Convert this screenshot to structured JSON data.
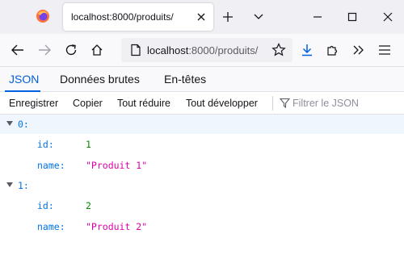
{
  "browser": {
    "tab_title": "localhost:8000/produits/",
    "url_host": "localhost",
    "url_rest": ":8000/produits/"
  },
  "viewer": {
    "tabs": [
      {
        "label": "JSON",
        "active": true
      },
      {
        "label": "Données brutes",
        "active": false
      },
      {
        "label": "En-têtes",
        "active": false
      }
    ]
  },
  "toolbar": {
    "save": "Enregistrer",
    "copy": "Copier",
    "collapse_all": "Tout réduire",
    "expand_all": "Tout développer",
    "filter_placeholder": "Filtrer le JSON"
  },
  "json": {
    "items": [
      {
        "index_label": "0:",
        "id_key": "id:",
        "id_value": "1",
        "name_key": "name:",
        "name_value": "\"Produit 1\""
      },
      {
        "index_label": "1:",
        "id_key": "id:",
        "id_value": "2",
        "name_key": "name:",
        "name_value": "\"Produit 2\""
      }
    ]
  },
  "colors": {
    "accent": "#0061e0",
    "json_key": "#0074e8",
    "json_number": "#058b00",
    "json_string": "#dd00a9"
  }
}
